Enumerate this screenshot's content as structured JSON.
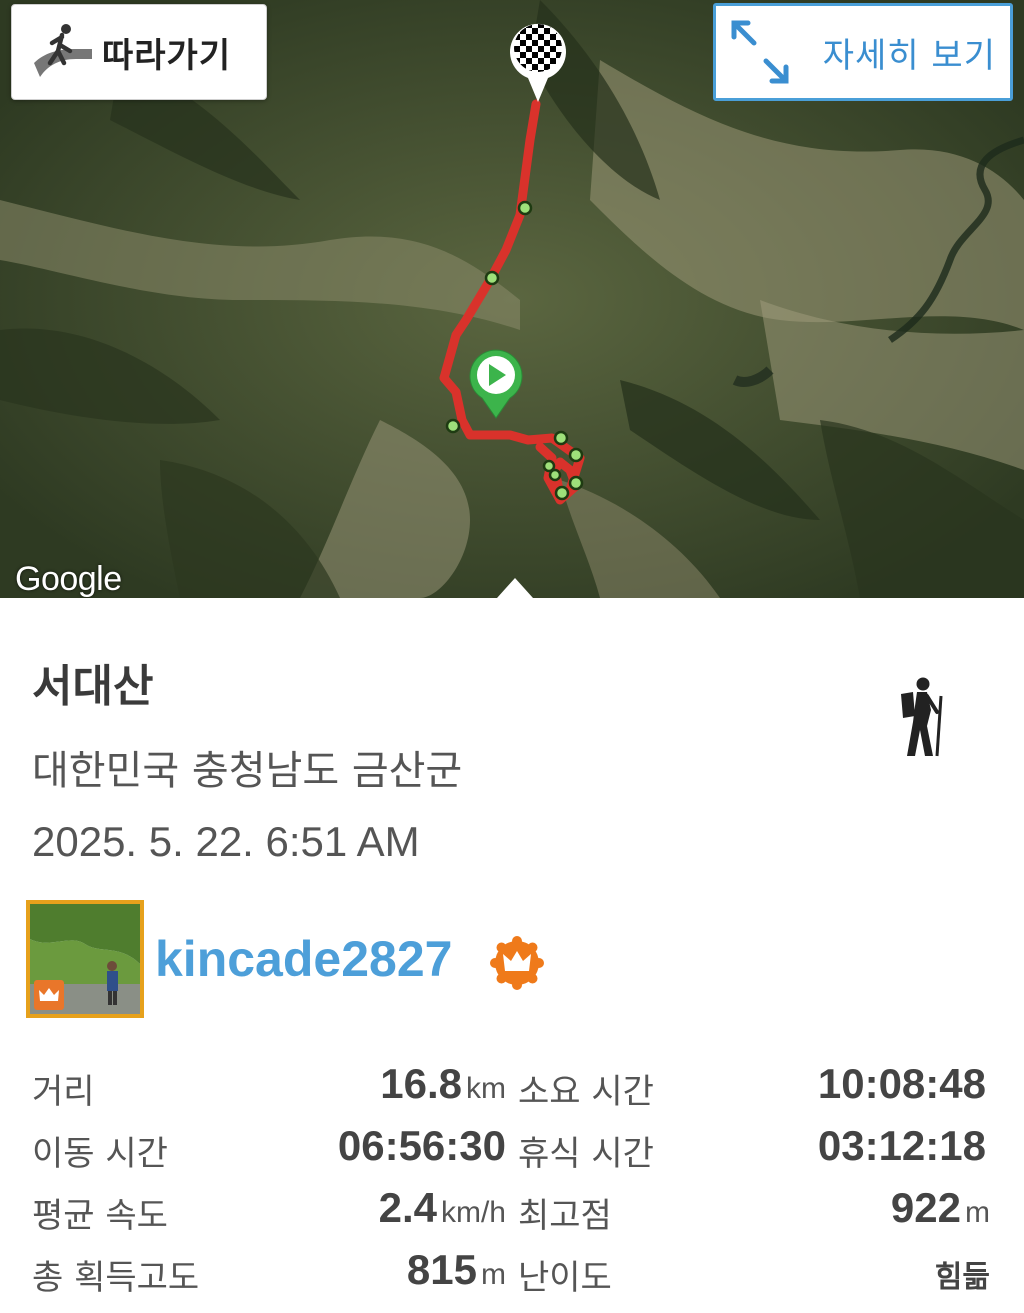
{
  "map": {
    "follow_label": "따라가기",
    "detail_label": "자세히 보기",
    "attribution": "Google",
    "route_color": "#d9322b",
    "start_marker_color": "#3cb44b",
    "waypoint_color": "#9ee07a"
  },
  "activity": {
    "title": "서대산",
    "location": "대한민국 충청남도 금산군",
    "datetime": "2025. 5. 22. 6:51 AM",
    "activity_icon": "hiker-icon"
  },
  "user": {
    "username": "kincade2827",
    "badge_icon": "crown-icon"
  },
  "stats": {
    "distance": {
      "label": "거리",
      "value": "16.8",
      "unit": "km"
    },
    "duration": {
      "label": "소요 시간",
      "value": "10:08:48"
    },
    "moving_time": {
      "label": "이동 시간",
      "value": "06:56:30"
    },
    "rest_time": {
      "label": "휴식 시간",
      "value": "03:12:18"
    },
    "avg_speed": {
      "label": "평균 속도",
      "value": "2.4",
      "unit": "km/h"
    },
    "max_elevation": {
      "label": "최고점",
      "value": "922",
      "unit": "m"
    },
    "total_ascent": {
      "label": "총 획득고도",
      "value": "815",
      "unit": "m"
    },
    "difficulty": {
      "label": "난이도",
      "value": "힘듦"
    }
  }
}
